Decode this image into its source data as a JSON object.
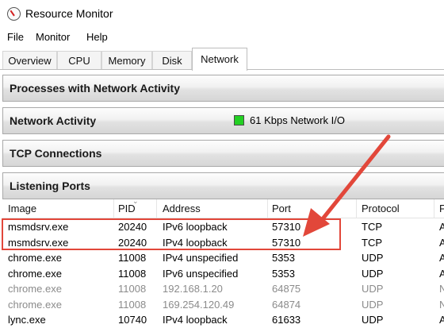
{
  "window": {
    "title": "Resource Monitor"
  },
  "menu": {
    "items": [
      "File",
      "Monitor",
      "Help"
    ]
  },
  "tabs": {
    "items": [
      "Overview",
      "CPU",
      "Memory",
      "Disk",
      "Network"
    ],
    "active": "Network"
  },
  "sections": {
    "processes": "Processes with Network Activity",
    "activity": "Network Activity",
    "activity_status": "61 Kbps Network I/O",
    "tcp": "TCP Connections",
    "listening": "Listening Ports"
  },
  "listening_table": {
    "headers": [
      "Image",
      "PID",
      "Address",
      "Port",
      "Protocol",
      "F"
    ],
    "rows": [
      {
        "image": "msmdsrv.exe",
        "pid": "20240",
        "address": "IPv6 loopback",
        "port": "57310",
        "protocol": "TCP",
        "extra": "A",
        "dim": false
      },
      {
        "image": "msmdsrv.exe",
        "pid": "20240",
        "address": "IPv4 loopback",
        "port": "57310",
        "protocol": "TCP",
        "extra": "A",
        "dim": false
      },
      {
        "image": "chrome.exe",
        "pid": "11008",
        "address": "IPv4 unspecified",
        "port": "5353",
        "protocol": "UDP",
        "extra": "A",
        "dim": false
      },
      {
        "image": "chrome.exe",
        "pid": "11008",
        "address": "IPv6 unspecified",
        "port": "5353",
        "protocol": "UDP",
        "extra": "A",
        "dim": false
      },
      {
        "image": "chrome.exe",
        "pid": "11008",
        "address": "192.168.1.20",
        "port": "64875",
        "protocol": "UDP",
        "extra": "N",
        "dim": true
      },
      {
        "image": "chrome.exe",
        "pid": "11008",
        "address": "169.254.120.49",
        "port": "64874",
        "protocol": "UDP",
        "extra": "N",
        "dim": true
      },
      {
        "image": "lync.exe",
        "pid": "10740",
        "address": "IPv4 loopback",
        "port": "61633",
        "protocol": "UDP",
        "extra": "A",
        "dim": false
      }
    ]
  },
  "colors": {
    "annotation": "#e2473a",
    "activity_indicator": "#23d023"
  }
}
